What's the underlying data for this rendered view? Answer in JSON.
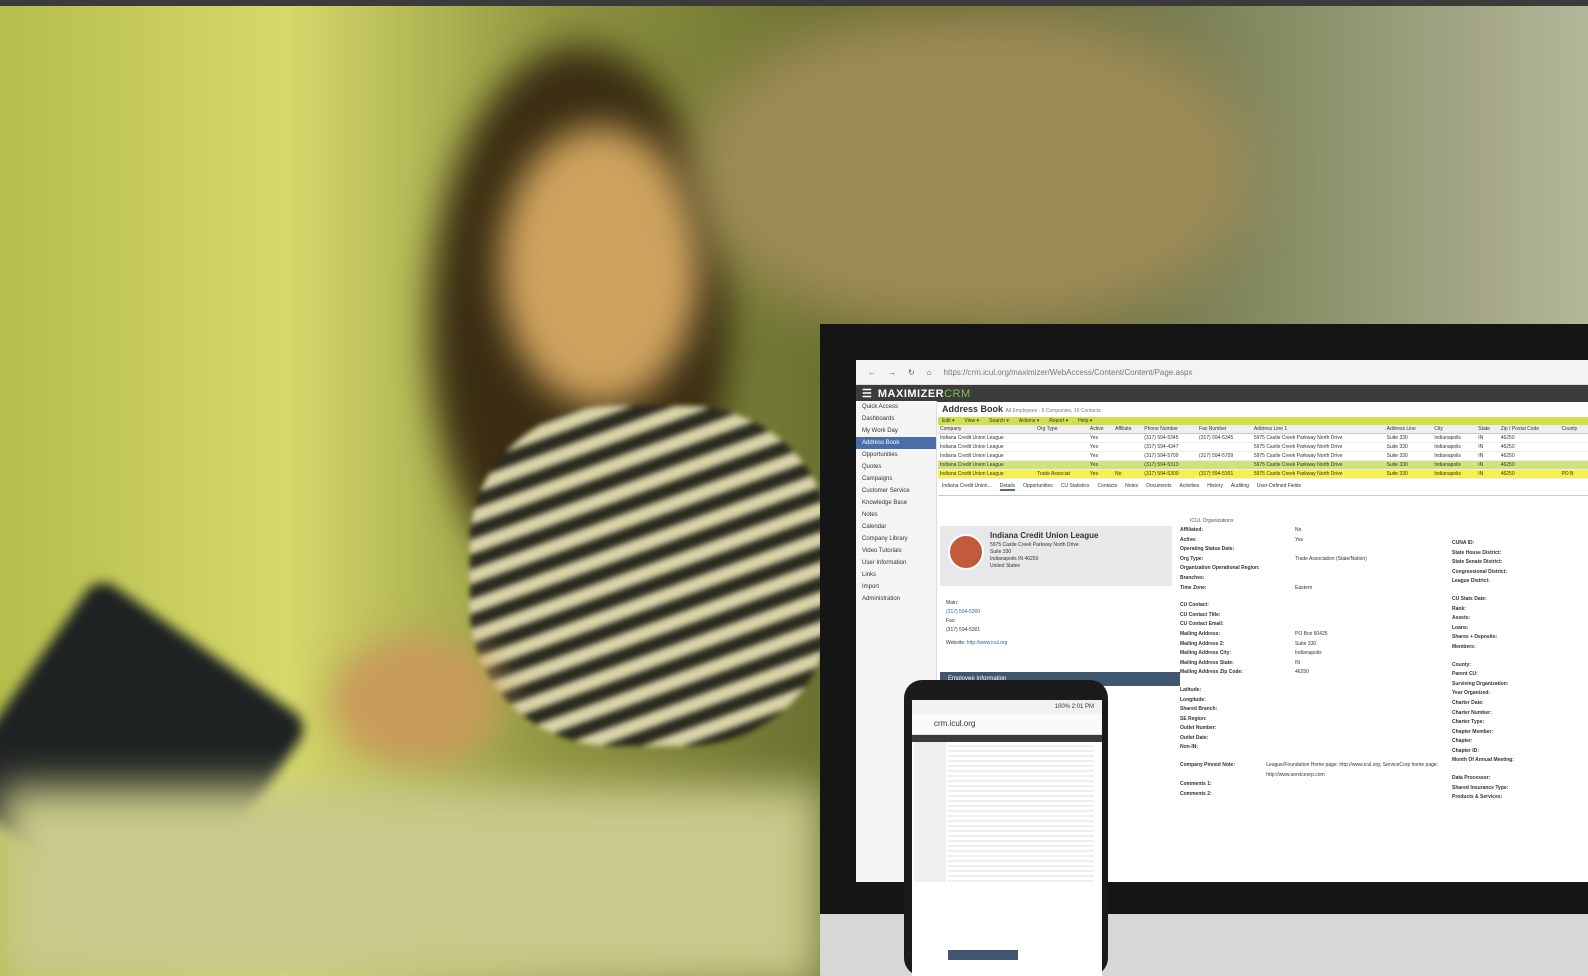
{
  "browser": {
    "url": "https://crm.icul.org/maximizer/WebAccess/Content/Content/Page.aspx"
  },
  "app": {
    "brand": "MAXIMIZER",
    "brand_suffix": "CRM"
  },
  "sidebar": {
    "items": [
      "Quick Access",
      "Dashboards",
      "My Work Day",
      "Address Book",
      "Opportunities",
      "Quotes",
      "Campaigns",
      "Customer Service",
      "Knowledge Base",
      "Notes",
      "Calendar",
      "Company Library",
      "Video Tutorials",
      "User Information",
      "Links",
      "Import",
      "Administration"
    ],
    "active": "Address Book"
  },
  "address_book": {
    "title": "Address Book",
    "subtitle": "All Employees · 5 Companies, 10 Contacts",
    "toolbar": [
      "Edit",
      "View",
      "Search",
      "Actions",
      "Report",
      "Help"
    ],
    "columns": [
      "Company",
      "Org Type",
      "Active",
      "Affiliate",
      "Phone Number",
      "Fax Number",
      "Address Line 1",
      "Address Line",
      "City",
      "State",
      "Zip / Postal Code",
      "County"
    ],
    "rows": [
      [
        "Indiana Credit Union League",
        "",
        "Yes",
        "",
        "(317) 594-5345",
        "(317) 594-5345",
        "5975 Castle Creek Parkway North Drive",
        "Suite 330",
        "Indianapolis",
        "IN",
        "46250",
        ""
      ],
      [
        "Indiana Credit Union League",
        "",
        "Yes",
        "",
        "(317) 594-4347",
        "",
        "5975 Castle Creek Parkway North Drive",
        "Suite 330",
        "Indianapolis",
        "IN",
        "46250",
        ""
      ],
      [
        "Indiana Credit Union League",
        "",
        "Yes",
        "",
        "(317) 594-5709",
        "(317) 594-5709",
        "5975 Castle Creek Parkway North Drive",
        "Suite 330",
        "Indianapolis",
        "IN",
        "46250",
        ""
      ],
      [
        "Indiana Credit Union League",
        "",
        "Yes",
        "",
        "(317) 594-5313",
        "",
        "5975 Castle Creek Parkway North Drive",
        "Suite 330",
        "Indianapolis",
        "IN",
        "46250",
        ""
      ],
      [
        "Indiana Credit Union League",
        "Trade Associat",
        "Yes",
        "No",
        "(317) 594-5300",
        "(317) 594-5301",
        "5975 Castle Creek Parkway North Drive",
        "Suite 330",
        "Indianapolis",
        "IN",
        "46250",
        "PO B"
      ]
    ]
  },
  "detail_tabs": [
    "Indiana Credit Union...",
    "Details",
    "Opportunities",
    "CU Statistics",
    "Contacts",
    "Notes",
    "Documents",
    "Activities",
    "History",
    "Auditing",
    "User-Defined Fields"
  ],
  "org_selector": "ICUL Organizations",
  "company": {
    "name": "Indiana Credit Union League",
    "address": [
      "5975 Castle Creek Parkway North Drive",
      "Suite 330",
      "Indianapolis IN 46250",
      "United States"
    ],
    "main_label": "Main:",
    "main": "(317) 594-5300",
    "fax_label": "Fax:",
    "fax": "(317) 594-5301",
    "website_label": "Website:",
    "website": "http://www.icul.org",
    "employee_section": "Employee Information"
  },
  "fields_col1": [
    [
      "Affiliated:",
      "No"
    ],
    [
      "Active:",
      "Yes"
    ],
    [
      "Operating Status Date:",
      ""
    ],
    [
      "Org Type:",
      "Trade Association (State/Nation)"
    ],
    [
      "Organization Operational Region:",
      ""
    ],
    [
      "Branches:",
      ""
    ],
    [
      "Time Zone:",
      "Eastern"
    ],
    [
      "",
      ""
    ],
    [
      "CU Contact:",
      ""
    ],
    [
      "CU Contact Title:",
      ""
    ],
    [
      "CU Contact Email:",
      ""
    ],
    [
      "Mailing Address:",
      "PO Box 50425"
    ],
    [
      "Mailing Address 2:",
      "Suite 330"
    ],
    [
      "Mailing Address City:",
      "Indianapolis"
    ],
    [
      "Mailing Address State:",
      "IN"
    ],
    [
      "Mailing Address Zip Code:",
      "46250"
    ],
    [
      "",
      ""
    ],
    [
      "Latitude:",
      ""
    ],
    [
      "Longitude:",
      ""
    ],
    [
      "Shared Branch:",
      ""
    ],
    [
      "SE Region:",
      ""
    ],
    [
      "Outlet Number:",
      ""
    ],
    [
      "Outlet Date:",
      ""
    ],
    [
      "Non-IN:",
      ""
    ],
    [
      "",
      ""
    ],
    [
      "Company Pinned Note:",
      "League/Foundation Home page: http://www.icul.org; ServiceCorp home page: http://www.serviceorp.com"
    ],
    [
      "Comments 1:",
      ""
    ],
    [
      "Comments 2:",
      ""
    ]
  ],
  "fields_col2": [
    "CUNA ID:",
    "State House District:",
    "State Senate District:",
    "Congressional District:",
    "League District:",
    "",
    "CU Stats Date:",
    "Rank:",
    "Assets:",
    "Loans:",
    "Shares + Deposits:",
    "Members:",
    "",
    "County:",
    "Parent CU:",
    "Surviving Organization:",
    "Year Organized:",
    "Charter Date:",
    "Charter Number:",
    "Charter Type:",
    "Chapter Member:",
    "Chapter:",
    "Chapter ID:",
    "Month Of Annual Meeting:",
    "",
    "Data Processor:",
    "Shared Insurance Type:",
    "Products & Services:"
  ],
  "phone": {
    "status": "100% 2:01 PM",
    "url": "crm.icul.org"
  }
}
